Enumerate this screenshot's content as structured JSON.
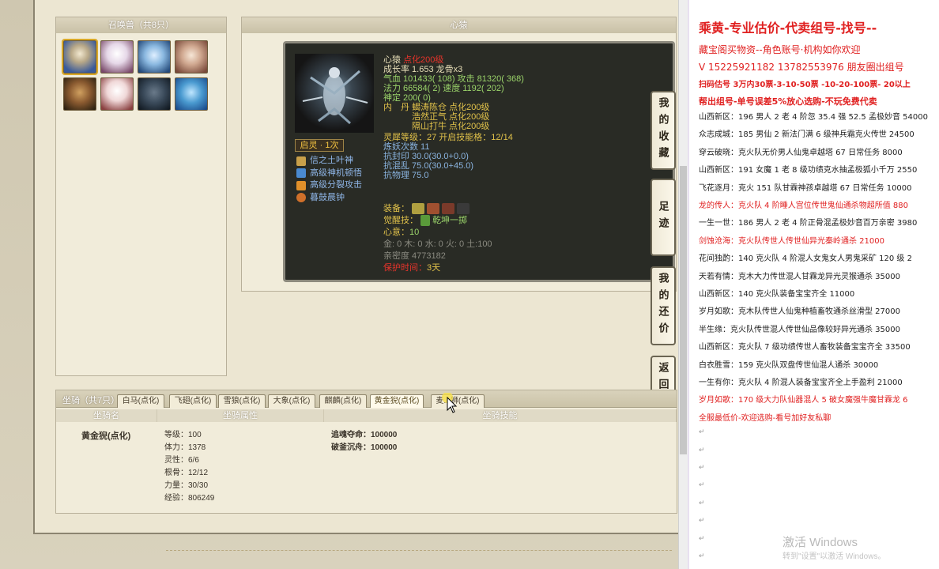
{
  "summon": {
    "title": "召唤兽（共8只）"
  },
  "detail": {
    "title": "心猿",
    "name": "心猿",
    "name_tag": "点化200级",
    "growth": "成长率 1.653  龙骨x3",
    "hp": "气血 101433( 108)  攻击 81320( 368)",
    "mp": "法力 66584( 2)  速度 1192( 202)",
    "spirit": "神定 200( 0)",
    "neidan_label": "内　丹",
    "neidan_1": "蝎涛陈仓  点化200级",
    "neidan_2": "浩然正气  点化200级",
    "neidan_3": "隔山打牛  点化200级",
    "soul_level": "灵犀等级：27  开启技能格：12/14",
    "refine": "炼妖次数  11",
    "resist_seal": "抗封印  30.0(30.0+0.0)",
    "resist_chaos": "抗混乱  75.0(30.0+45.0)",
    "resist_phys": "抗物理  75.0",
    "equip_label": "装备：",
    "awaken_label": "觉醒技：",
    "awaken_value": "乾坤一掷",
    "heart_label": "心意：",
    "heart_value": "10",
    "elements": "金: 0  木: 0  水: 0  火: 0  土:100",
    "intimacy": "亲密度  4773182",
    "protect_label": "保护时间：",
    "protect_value": "3天",
    "badge": "启灵 · 1次",
    "skills": [
      "信之土叶神",
      "高级神机顿悟",
      "高级分裂攻击",
      "暮鼓晨钟"
    ]
  },
  "side_buttons": [
    "我的收藏",
    "足迹",
    "我的还价",
    "返回顶部"
  ],
  "mount": {
    "title": "坐骑（共7只）",
    "tabs": [
      "白马(点化)",
      "飞翅(点化)",
      "雪狼(点化)",
      "大象(点化)",
      "麒麟(点化)",
      "黄金猊(点化)",
      "麦...狮(点化)"
    ],
    "active_tab": 5,
    "col_name": "坐骑名",
    "col_attr": "坐骑属性",
    "col_skill": "坐骑技能",
    "name": "黄金猊(点化)",
    "attrs": [
      "等级：100",
      "体力：1378",
      "灵性：6/6",
      "根骨：12/12",
      "力量：30/30",
      "经验：806249"
    ],
    "skills": [
      "追魂夺命：100000",
      "破釜沉舟：100000"
    ]
  },
  "doc": {
    "title": "乘黄-专业估价-代卖组号-找号--",
    "line_a": "藏宝阁买物资--角色账号·机构如你欢迎",
    "line_b": "V 15225921182   13782553976  朋友圈出组号",
    "line_c": "扫码估号 3万内30票-3-10-50票  -10-20-100票- 20以上",
    "line_d": "帮出组号-单号误差5%放心选购-不玩免费代卖",
    "rows": [
      {
        "text": "山西新区：196 男人 2 老 4 阶忽 35.4 强 52.5 孟极妙音 54000",
        "color": "#222222"
      },
      {
        "text": "众志成城：185 男仙 2 新法门满 6 级神兵霜克火传世 24500",
        "color": "#222222"
      },
      {
        "text": "穿云破晓：克火队无价男人仙鬼卓越塔 67 日常任务 8000",
        "color": "#222222"
      },
      {
        "text": "山西新区：191 女魔 1 老 8 级功绩克水抽孟极狐小千万 2550",
        "color": "#222222"
      },
      {
        "text": "飞花逐月：克火 151 队甘霖神孩卓越塔 67 日常任务 10000",
        "color": "#222222"
      },
      {
        "text": "龙的传人：克火队 4 阶睡人宫位传世鬼仙通杀物超所值 880",
        "color": "#e02020"
      },
      {
        "text": "一生一世：186 男人 2 老 4 阶正骨混孟极妙音百万亲密 3980",
        "color": "#222222"
      },
      {
        "text": "剑蚀沧海：克火队传世人传世仙异光秦岭通杀 21000",
        "color": "#e02020"
      },
      {
        "text": "花间独酌：140 克火队 4 阶混人女鬼女人男鬼采矿 120 级 2",
        "color": "#222222"
      },
      {
        "text": "天若有情：克木大力传世混人甘霖龙异光灵猴通杀 35000",
        "color": "#222222"
      },
      {
        "text": "山西新区：140 克火队装备宝宝齐全 11000",
        "color": "#222222"
      },
      {
        "text": "岁月如歌：克木队传世人仙鬼种植畜牧通杀丝滑型 27000",
        "color": "#222222"
      },
      {
        "text": "半生缘：克火队传世混人传世仙品像较好异光通杀 35000",
        "color": "#222222"
      },
      {
        "text": "山西新区：克火队 7 级功绩传世人畜牧装备宝宝齐全 33500",
        "color": "#222222"
      },
      {
        "text": "白衣胜雪：159 克火队双盘传世仙混人通杀 30000",
        "color": "#222222"
      },
      {
        "text": "一生有你：克火队 4 阶混人装备宝宝齐全上手盈利 21000",
        "color": "#222222"
      },
      {
        "text": "岁月如歌：170 级大力队仙器混人 5 破女魔强牛魔甘霖龙 6",
        "color": "#e02020"
      },
      {
        "text": "全服最低价-欢迎选购-看号加好友私聊",
        "color": "#e02020"
      }
    ],
    "para_mark": "↵"
  },
  "watermark": {
    "line1": "激活 Windows",
    "line2": "转到\"设置\"以激活 Windows。"
  }
}
